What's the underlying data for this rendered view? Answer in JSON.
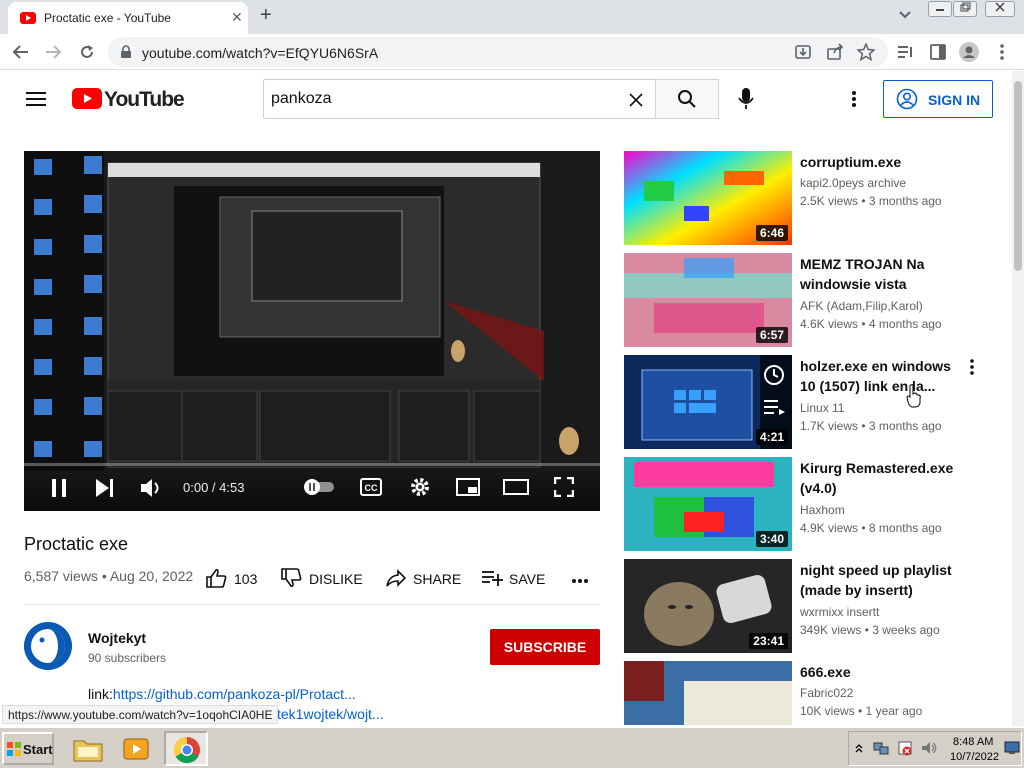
{
  "browser": {
    "tab_title": "Proctatic exe - YouTube",
    "tab_close": "✕",
    "new_tab": "+",
    "url": "youtube.com/watch?v=EfQYU6N6SrA",
    "status_url": "https://www.youtube.com/watch?v=1oqohCIA0HE"
  },
  "header": {
    "logo_text": "YouTube",
    "search_value": "pankoza",
    "signin_label": "SIGN IN"
  },
  "player": {
    "time": "0:00 / 4:53"
  },
  "video": {
    "title": "Proctatic exe",
    "meta": "6,587 views • Aug 20, 2022",
    "likes": "103",
    "dislike_label": "DISLIKE",
    "share_label": "SHARE",
    "save_label": "SAVE"
  },
  "channel": {
    "name": "Wojtekyt",
    "subscribers": "90 subscribers",
    "subscribe_label": "SUBSCRIBE"
  },
  "description": {
    "prefix": "link:",
    "link1": "https://github.com/pankoza-pl/Protact...",
    "link2": "wojtek1wojtek/wojt..."
  },
  "recommendations": [
    {
      "title": "corruptium.exe",
      "channel": "kapi2.0peys archive",
      "stats": "2.5K views • 3 months ago",
      "duration": "6:46"
    },
    {
      "title": "MEMZ TROJAN Na windowsie vista",
      "channel": "AFK (Adam,Filip,Karol)",
      "stats": "4.6K views • 4 months ago",
      "duration": "6:57"
    },
    {
      "title": "holzer.exe en windows 10 (1507) link en la...",
      "channel": "Linux 11",
      "stats": "1.7K views • 3 months ago",
      "duration": "4:21"
    },
    {
      "title": "Kirurg Remastered.exe (v4.0)",
      "channel": "Haxhom",
      "stats": "4.9K views • 8 months ago",
      "duration": "3:40"
    },
    {
      "title": "night speed up playlist (made by insertt)",
      "channel": "wxrmixx insertt",
      "stats": "349K views • 3 weeks ago",
      "duration": "23:41"
    },
    {
      "title": "666.exe",
      "channel": "Fabric022",
      "stats": "10K views • 1 year ago",
      "duration": ""
    }
  ],
  "taskbar": {
    "start_label": "Start",
    "time": "8:48 AM",
    "date": "10/7/2022"
  },
  "colors": {
    "youtube_red": "#ff0000",
    "link_blue": "#065fd4",
    "subscribe_red": "#cc0000"
  }
}
